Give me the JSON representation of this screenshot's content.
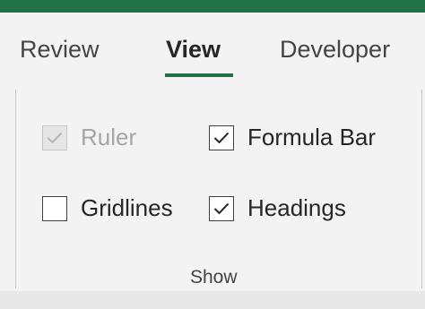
{
  "colors": {
    "accent": "#217346",
    "background": "#f3f3f3"
  },
  "tabs": [
    {
      "label": "Review",
      "selected": false
    },
    {
      "label": "View",
      "selected": true
    },
    {
      "label": "Developer",
      "selected": false
    }
  ],
  "show_group": {
    "title": "Show",
    "options": {
      "ruler": {
        "label": "Ruler",
        "checked": true,
        "enabled": false
      },
      "formula_bar": {
        "label": "Formula Bar",
        "checked": true,
        "enabled": true
      },
      "gridlines": {
        "label": "Gridlines",
        "checked": false,
        "enabled": true
      },
      "headings": {
        "label": "Headings",
        "checked": true,
        "enabled": true
      }
    }
  }
}
